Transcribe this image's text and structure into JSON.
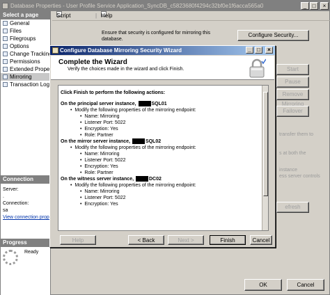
{
  "outer_window": {
    "title": "Database Properties - User Profile Service Application_SyncDB_c5823680f4294c32bf0e1f6acca565a0",
    "minimize": "_",
    "maximize": "□",
    "close": "×"
  },
  "left_pane": {
    "header": "Select a page",
    "items": [
      {
        "label": "General"
      },
      {
        "label": "Files"
      },
      {
        "label": "Filegroups"
      },
      {
        "label": "Options"
      },
      {
        "label": "Change Tracking"
      },
      {
        "label": "Permissions"
      },
      {
        "label": "Extended Properties"
      },
      {
        "label": "Mirroring"
      },
      {
        "label": "Transaction Log Shipping"
      }
    ],
    "selected": "Mirroring",
    "connection": {
      "header": "Connection",
      "server_label": "Server:",
      "server_value": ".",
      "connection_label": "Connection:",
      "connection_value": "sa",
      "view_link": "View connection properties"
    },
    "progress": {
      "header": "Progress",
      "status": "Ready"
    }
  },
  "toolbar": {
    "script_label": "Script",
    "help_label": "Help"
  },
  "main": {
    "security_text": "Ensure that security is configured for mirroring this database.",
    "configure_security_button": "Configure Security...",
    "side_buttons": [
      "Start Mirroring",
      "Pause",
      "Remove Mirroring",
      "Failover"
    ],
    "partial_texts": [
      "transfer them to",
      "s at both the",
      "instance",
      "ess server controls",
      "efresh"
    ],
    "ok_button": "OK",
    "cancel_button": "Cancel"
  },
  "wizard": {
    "title": "Configure Database Mirroring Security Wizard",
    "header_title": "Complete the Wizard",
    "header_subtitle": "Verify the choices made in the wizard and click Finish.",
    "intro": "Click Finish to perform the following actions:",
    "sections": [
      {
        "heading_prefix": "On the principal server instance,",
        "heading_suffix": "SQL01",
        "modify_text": "Modify the following properties of the mirroring endpoint:",
        "props": [
          "Name: Mirroring",
          "Listener Port: 5022",
          "Encryption: Yes",
          "Role: Partner"
        ]
      },
      {
        "heading_prefix": "On the mirror server instance,",
        "heading_suffix": "SQL02",
        "modify_text": "Modify the following properties of the mirroring endpoint:",
        "props": [
          "Name: Mirroring",
          "Listener Port: 5022",
          "Encryption: Yes",
          "Role: Partner"
        ]
      },
      {
        "heading_prefix": "On the witness server instance,",
        "heading_suffix": "DC02",
        "modify_text": "Modify the following properties of the mirroring endpoint:",
        "props": [
          "Name: Mirroring",
          "Listener Port: 5022",
          "Encryption: Yes"
        ]
      }
    ],
    "buttons": {
      "help": "Help",
      "back": "< Back",
      "next": "Next >",
      "finish": "Finish",
      "cancel": "Cancel"
    }
  }
}
